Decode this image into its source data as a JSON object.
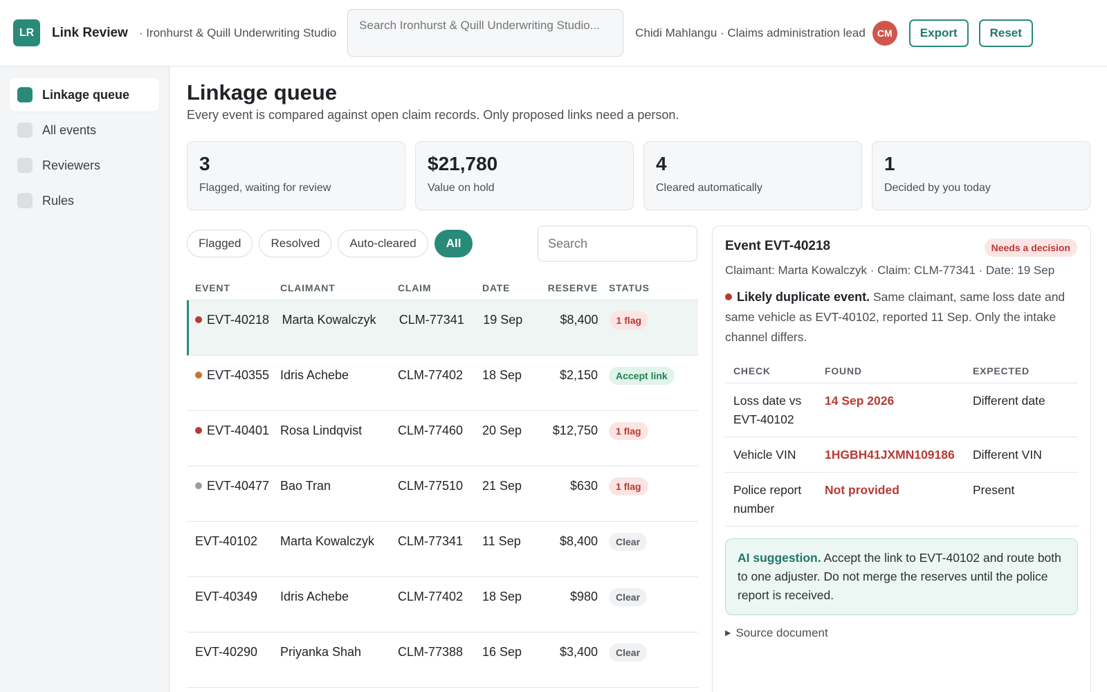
{
  "header": {
    "logo": "LR",
    "app_title": "Link Review",
    "org": "· Ironhurst & Quill Underwriting Studio",
    "search_placeholder": "Search Ironhurst & Quill Underwriting Studio...",
    "user": "Chidi Mahlangu · Claims administration lead",
    "avatar": "CM",
    "export_label": "Export",
    "reset_label": "Reset"
  },
  "sidebar": {
    "items": [
      {
        "label": "Linkage queue",
        "active": true
      },
      {
        "label": "All events",
        "active": false
      },
      {
        "label": "Reviewers",
        "active": false
      },
      {
        "label": "Rules",
        "active": false
      }
    ]
  },
  "main": {
    "title": "Linkage queue",
    "subtitle": "Every event is compared against open claim records. Only proposed links need a person.",
    "stats": [
      {
        "value": "3",
        "label": "Flagged, waiting for review"
      },
      {
        "value": "$21,780",
        "label": "Value on hold"
      },
      {
        "value": "4",
        "label": "Cleared automatically"
      },
      {
        "value": "1",
        "label": "Decided by you today"
      }
    ],
    "filters": [
      {
        "label": "Flagged",
        "active": false
      },
      {
        "label": "Resolved",
        "active": false
      },
      {
        "label": "Auto-cleared",
        "active": false
      },
      {
        "label": "All",
        "active": true
      }
    ],
    "search_placeholder": "Search"
  },
  "table": {
    "columns": [
      "EVENT",
      "CLAIMANT",
      "CLAIM",
      "DATE",
      "RESERVE",
      "STATUS"
    ],
    "rows": [
      {
        "event": "EVT-40218",
        "claimant": "Marta Kowalczyk",
        "claim": "CLM-77341",
        "date": "19 Sep",
        "reserve": "$8,400",
        "status": "1 flag",
        "kind": "flag",
        "dot": "#b83a33"
      },
      {
        "event": "EVT-40355",
        "claimant": "Idris Achebe",
        "claim": "CLM-77402",
        "date": "18 Sep",
        "reserve": "$2,150",
        "status": "Accept link",
        "kind": "accept",
        "dot": "#c9722e"
      },
      {
        "event": "EVT-40401",
        "claimant": "Rosa Lindqvist",
        "claim": "CLM-77460",
        "date": "20 Sep",
        "reserve": "$12,750",
        "status": "1 flag",
        "kind": "flag",
        "dot": "#b83a33"
      },
      {
        "event": "EVT-40477",
        "claimant": "Bao Tran",
        "claim": "CLM-77510",
        "date": "21 Sep",
        "reserve": "$630",
        "status": "1 flag",
        "kind": "flag",
        "dot": "#9a9ea4"
      },
      {
        "event": "EVT-40102",
        "claimant": "Marta Kowalczyk",
        "claim": "CLM-77341",
        "date": "11 Sep",
        "reserve": "$8,400",
        "status": "Clear",
        "kind": "clear",
        "dot": ""
      },
      {
        "event": "EVT-40349",
        "claimant": "Idris Achebe",
        "claim": "CLM-77402",
        "date": "18 Sep",
        "reserve": "$980",
        "status": "Clear",
        "kind": "clear",
        "dot": ""
      },
      {
        "event": "EVT-40290",
        "claimant": "Priyanka Shah",
        "claim": "CLM-77388",
        "date": "16 Sep",
        "reserve": "$3,400",
        "status": "Clear",
        "kind": "clear",
        "dot": ""
      }
    ]
  },
  "detail": {
    "title": "Event EVT-40218",
    "badge": "Needs a decision",
    "meta": "Claimant: Marta Kowalczyk · Claim: CLM-77341 · Date: 19 Sep",
    "alert_title": "Likely duplicate event.",
    "alert_text": " Same claimant, same loss date and same vehicle as EVT-40102, reported 11 Sep. Only the intake channel differs.",
    "columns": [
      "CHECK",
      "FOUND",
      "EXPECTED"
    ],
    "checks": [
      {
        "check": "Loss date vs EVT-40102",
        "found": "14 Sep 2026",
        "expected": "Different date"
      },
      {
        "check": "Vehicle VIN",
        "found": "1HGBH41JXMN109186",
        "expected": "Different VIN"
      },
      {
        "check": "Police report number",
        "found": "Not provided",
        "expected": "Present"
      }
    ],
    "ai_label": "AI suggestion.",
    "ai_text": " Accept the link to EVT-40102 and route both to one adjuster. Do not merge the reserves until the police report is received.",
    "source_label": "Source document"
  },
  "colors": {
    "accent": "#2a8a78",
    "flag": "#b83a33",
    "accept": "#23804f"
  }
}
